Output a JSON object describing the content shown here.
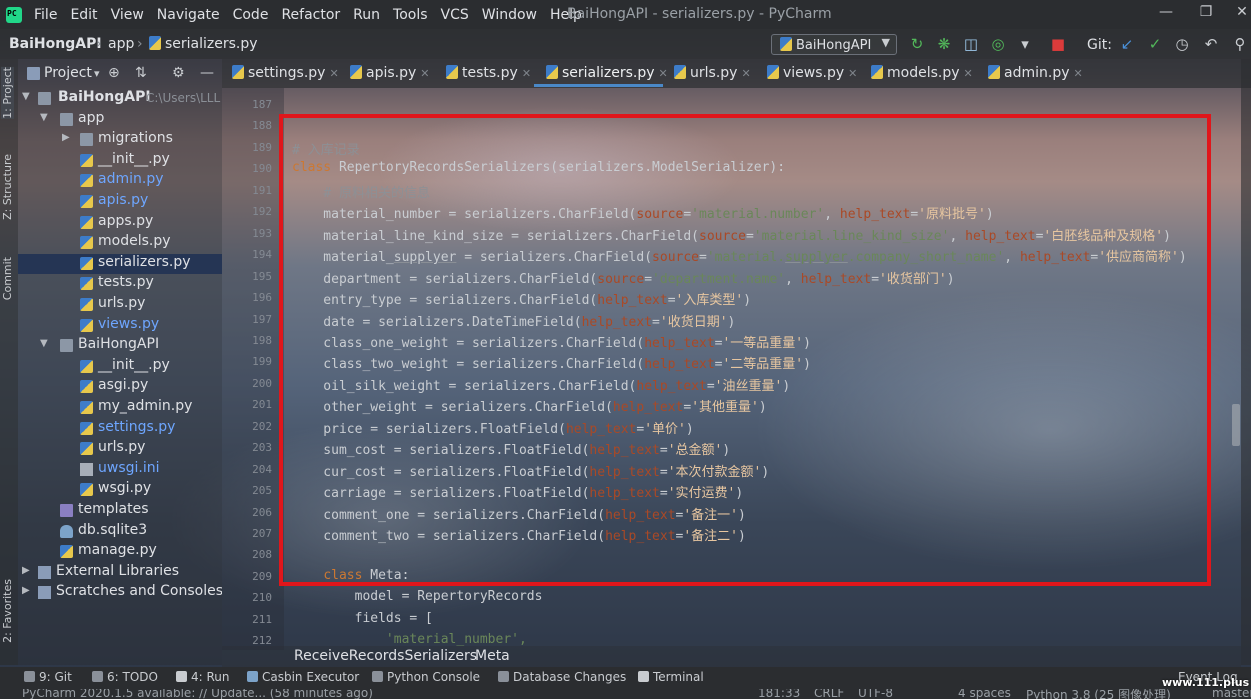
{
  "menubar": {
    "items": [
      "File",
      "Edit",
      "View",
      "Navigate",
      "Code",
      "Refactor",
      "Run",
      "Tools",
      "VCS",
      "Window",
      "Help"
    ],
    "window_title": "BaiHongAPI - serializers.py - PyCharm"
  },
  "navbar": {
    "crumbs": [
      "BaiHongAPI",
      "app",
      "serializers.py"
    ],
    "run_config": "BaiHongAPI",
    "git_label": "Git:"
  },
  "left_tabs": [
    "1: Project",
    "Z: Structure",
    "Commit",
    "2: Favorites"
  ],
  "project": {
    "title": "Project",
    "root_name": "BaiHongAPI",
    "root_path": "C:\\Users\\LLL",
    "tree": [
      {
        "label": "app",
        "kind": "folder",
        "depth": 1,
        "expanded": true
      },
      {
        "label": "migrations",
        "kind": "folder",
        "depth": 2,
        "expanded": false
      },
      {
        "label": "__init__.py",
        "kind": "py",
        "depth": 2
      },
      {
        "label": "admin.py",
        "kind": "py",
        "depth": 2,
        "modified": true
      },
      {
        "label": "apis.py",
        "kind": "py",
        "depth": 2,
        "modified": true
      },
      {
        "label": "apps.py",
        "kind": "py",
        "depth": 2
      },
      {
        "label": "models.py",
        "kind": "py",
        "depth": 2
      },
      {
        "label": "serializers.py",
        "kind": "py",
        "depth": 2,
        "selected": true
      },
      {
        "label": "tests.py",
        "kind": "py",
        "depth": 2
      },
      {
        "label": "urls.py",
        "kind": "py",
        "depth": 2
      },
      {
        "label": "views.py",
        "kind": "py",
        "depth": 2,
        "modified": true
      },
      {
        "label": "BaiHongAPI",
        "kind": "folder",
        "depth": 1,
        "expanded": true
      },
      {
        "label": "__init__.py",
        "kind": "py",
        "depth": 2
      },
      {
        "label": "asgi.py",
        "kind": "py",
        "depth": 2
      },
      {
        "label": "my_admin.py",
        "kind": "py",
        "depth": 2
      },
      {
        "label": "settings.py",
        "kind": "py",
        "depth": 2,
        "modified": true
      },
      {
        "label": "urls.py",
        "kind": "py",
        "depth": 2
      },
      {
        "label": "uwsgi.ini",
        "kind": "ini",
        "depth": 2,
        "modified": true
      },
      {
        "label": "wsgi.py",
        "kind": "py",
        "depth": 2
      },
      {
        "label": "templates",
        "kind": "folder",
        "depth": 1
      },
      {
        "label": "db.sqlite3",
        "kind": "db",
        "depth": 1
      },
      {
        "label": "manage.py",
        "kind": "py",
        "depth": 1
      },
      {
        "label": "External Libraries",
        "kind": "lib",
        "depth": 0
      },
      {
        "label": "Scratches and Consoles",
        "kind": "scratch",
        "depth": 0
      }
    ]
  },
  "tabs": [
    {
      "label": "settings.py"
    },
    {
      "label": "apis.py"
    },
    {
      "label": "tests.py"
    },
    {
      "label": "serializers.py",
      "active": true
    },
    {
      "label": "urls.py"
    },
    {
      "label": "views.py"
    },
    {
      "label": "models.py"
    },
    {
      "label": "admin.py"
    }
  ],
  "editor": {
    "line_numbers": [
      "187",
      "188",
      "189",
      "190",
      "191",
      "192",
      "193",
      "194",
      "195",
      "196",
      "197",
      "198",
      "199",
      "200",
      "201",
      "202",
      "203",
      "204",
      "205",
      "206",
      "207",
      "208",
      "209",
      "210",
      "211",
      "212"
    ],
    "lines": [
      [],
      [],
      [
        [
          "cm",
          "# 入库记录"
        ]
      ],
      [
        [
          "kw",
          "class "
        ],
        [
          "t",
          "RepertoryRecordsSerializers(serializers.ModelSerializer):"
        ]
      ],
      [
        [
          "t",
          "    "
        ],
        [
          "cm",
          "# 原料相关的信息"
        ]
      ],
      [
        [
          "t",
          "    material_number = serializers.CharField("
        ],
        [
          "kwarg",
          "source"
        ],
        [
          "t",
          "="
        ],
        [
          "str",
          "'material.number'"
        ],
        [
          "t",
          ", "
        ],
        [
          "kwarg",
          "help_text"
        ],
        [
          "t",
          "="
        ],
        [
          "str-hl",
          "'原料批号'"
        ],
        [
          "t",
          ")"
        ]
      ],
      [
        [
          "t",
          "    material_line_kind_size = serializers.CharField("
        ],
        [
          "kwarg",
          "source"
        ],
        [
          "t",
          "="
        ],
        [
          "str",
          "'material.line_kind_size'"
        ],
        [
          "t",
          ", "
        ],
        [
          "kwarg",
          "help_text"
        ],
        [
          "t",
          "="
        ],
        [
          "str-hl",
          "'白胚线品种及规格'"
        ],
        [
          "t",
          ")"
        ]
      ],
      [
        [
          "t",
          "    material_"
        ],
        [
          "u",
          "supplyer"
        ],
        [
          "t",
          " = serializers.CharField("
        ],
        [
          "kwarg",
          "source"
        ],
        [
          "t",
          "="
        ],
        [
          "str",
          "'material."
        ],
        [
          "su",
          "supplyer"
        ],
        [
          "str",
          ".company_short_name'"
        ],
        [
          "t",
          ", "
        ],
        [
          "kwarg",
          "help_text"
        ],
        [
          "t",
          "="
        ],
        [
          "str-hl",
          "'供应商简称'"
        ],
        [
          "t",
          ")"
        ]
      ],
      [
        [
          "t",
          "    department = serializers.CharField("
        ],
        [
          "kwarg",
          "source"
        ],
        [
          "t",
          "="
        ],
        [
          "str",
          "'department.name'"
        ],
        [
          "t",
          ", "
        ],
        [
          "kwarg",
          "help_text"
        ],
        [
          "t",
          "="
        ],
        [
          "str-hl",
          "'收货部门'"
        ],
        [
          "t",
          ")"
        ]
      ],
      [
        [
          "t",
          "    entry_type = serializers.CharField("
        ],
        [
          "kwarg",
          "help_text"
        ],
        [
          "t",
          "="
        ],
        [
          "str-hl",
          "'入库类型'"
        ],
        [
          "t",
          ")"
        ]
      ],
      [
        [
          "t",
          "    date = serializers.DateTimeField("
        ],
        [
          "kwarg",
          "help_text"
        ],
        [
          "t",
          "="
        ],
        [
          "str-hl",
          "'收货日期'"
        ],
        [
          "t",
          ")"
        ]
      ],
      [
        [
          "t",
          "    class_one_weight = serializers.CharField("
        ],
        [
          "kwarg",
          "help_text"
        ],
        [
          "t",
          "="
        ],
        [
          "str-hl",
          "'一等品重量'"
        ],
        [
          "t",
          ")"
        ]
      ],
      [
        [
          "t",
          "    class_two_weight = serializers.CharField("
        ],
        [
          "kwarg",
          "help_text"
        ],
        [
          "t",
          "="
        ],
        [
          "str-hl",
          "'二等品重量'"
        ],
        [
          "t",
          ")"
        ]
      ],
      [
        [
          "t",
          "    oil_silk_weight = serializers.CharField("
        ],
        [
          "kwarg",
          "help_text"
        ],
        [
          "t",
          "="
        ],
        [
          "str-hl",
          "'油丝重量'"
        ],
        [
          "t",
          ")"
        ]
      ],
      [
        [
          "t",
          "    other_weight = serializers.CharField("
        ],
        [
          "kwarg",
          "help_text"
        ],
        [
          "t",
          "="
        ],
        [
          "str-hl",
          "'其他重量'"
        ],
        [
          "t",
          ")"
        ]
      ],
      [
        [
          "t",
          "    price = serializers.FloatField("
        ],
        [
          "kwarg",
          "help_text"
        ],
        [
          "t",
          "="
        ],
        [
          "str-hl",
          "'单价'"
        ],
        [
          "t",
          ")"
        ]
      ],
      [
        [
          "t",
          "    sum_cost = serializers.FloatField("
        ],
        [
          "kwarg",
          "help_text"
        ],
        [
          "t",
          "="
        ],
        [
          "str-hl",
          "'总金额'"
        ],
        [
          "t",
          ")"
        ]
      ],
      [
        [
          "t",
          "    cur_cost = serializers.FloatField("
        ],
        [
          "kwarg",
          "help_text"
        ],
        [
          "t",
          "="
        ],
        [
          "str-hl",
          "'本次付款金额'"
        ],
        [
          "t",
          ")"
        ]
      ],
      [
        [
          "t",
          "    carriage = serializers.FloatField("
        ],
        [
          "kwarg",
          "help_text"
        ],
        [
          "t",
          "="
        ],
        [
          "str-hl",
          "'实付运费'"
        ],
        [
          "t",
          ")"
        ]
      ],
      [
        [
          "t",
          "    comment_one = serializers.CharField("
        ],
        [
          "kwarg",
          "help_text"
        ],
        [
          "t",
          "="
        ],
        [
          "str-hl",
          "'备注一'"
        ],
        [
          "t",
          ")"
        ]
      ],
      [
        [
          "t",
          "    comment_two = serializers.CharField("
        ],
        [
          "kwarg",
          "help_text"
        ],
        [
          "t",
          "="
        ],
        [
          "str-hl",
          "'备注二'"
        ],
        [
          "t",
          ")"
        ]
      ],
      [],
      [
        [
          "t",
          "    "
        ],
        [
          "kw",
          "class "
        ],
        [
          "t",
          "Meta:"
        ]
      ],
      [
        [
          "t",
          "        model = RepertoryRecords"
        ]
      ],
      [
        [
          "t",
          "        fields = ["
        ]
      ],
      [
        [
          "t",
          "            "
        ],
        [
          "str",
          "'material_number',"
        ]
      ]
    ]
  },
  "editor_breadcrumbs": [
    "ReceiveRecordsSerializers",
    "Meta"
  ],
  "bottom_tools": [
    "9: Git",
    "6: TODO",
    "4: Run",
    "Casbin Executor",
    "Python Console",
    "Database Changes",
    "Terminal",
    "Event Log"
  ],
  "status": {
    "message": "PyCharm 2020.1.5 available: // Update... (58 minutes ago)",
    "position": "181:33",
    "line_sep": "CRLF",
    "encoding": "UTF-8",
    "indent": "4 spaces",
    "interpreter": "Python 3.8 (25 图像处理)",
    "branch": "master"
  },
  "watermark": "www.111.plus",
  "colors": {
    "highlight_box": "#e0161b",
    "keyword": "#cc7832",
    "string": "#6a8759",
    "kwarg": "#aa4926",
    "comment": "#8d9095",
    "link_blue": "#6ea6ff"
  }
}
